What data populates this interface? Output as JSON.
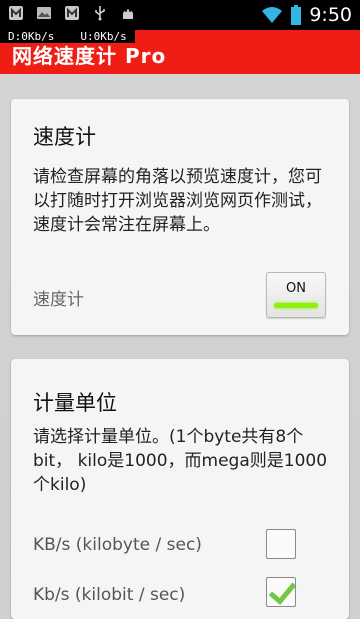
{
  "status_bar": {
    "time": "9:50",
    "icons_left": [
      "app-notification-icon",
      "photo-notification-icon",
      "app-notification-icon-2",
      "usb-icon",
      "android-debug-icon"
    ],
    "icons_right": [
      "wifi-icon",
      "battery-icon"
    ]
  },
  "speed_overlay": {
    "download": "D:0Kb/s",
    "upload": "U:0Kb/s"
  },
  "app": {
    "title": "网络速度计 Pro",
    "accent_color": "#ef1d14"
  },
  "speedometer_card": {
    "title": "速度计",
    "description": "请检查屏幕的角落以预览速度计，您可以打随时打开浏览器浏览网页作测试，速度计会常注在屏幕上。",
    "setting_label": "速度计",
    "toggle_label": "ON",
    "toggle_state": true
  },
  "units_card": {
    "title": "计量单位",
    "description": "请选择计量单位。(1个byte共有8个bit， kilo是1000，而mega则是1000个kilo)",
    "options": [
      {
        "label": "KB/s (kilobyte / sec)",
        "checked": false
      },
      {
        "label": "Kb/s (kilobit / sec)",
        "checked": true
      }
    ]
  }
}
